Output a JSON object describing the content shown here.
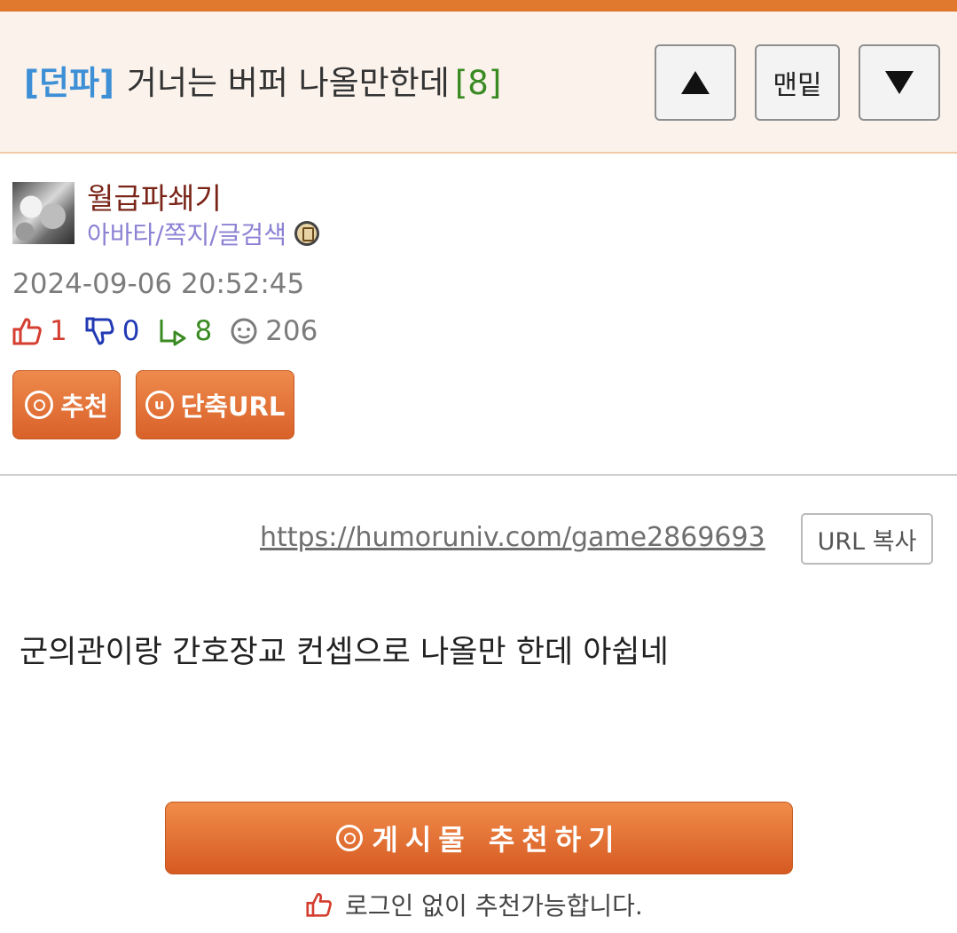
{
  "header": {
    "category": "[던파]",
    "title": "거너는 버퍼 나올만한데",
    "comment_count": "[8]",
    "nav_up_icon": "triangle-up-icon",
    "nav_bottom_label": "맨밑",
    "nav_down_icon": "triangle-down-icon"
  },
  "author": {
    "name": "월급파쇄기",
    "links": "아바타/쪽지/글검색",
    "level_icon": "level-badge-icon"
  },
  "post": {
    "date": "2024-09-06 20:52:45",
    "upvotes": "1",
    "downvotes": "0",
    "replies": "8",
    "views": "206",
    "recommend_label": "추천",
    "shorturl_label": "단축URL",
    "shorturl_icon_letter": "u",
    "url": "https://humoruniv.com/game2869693",
    "copy_label": "URL 복사",
    "content": "군의관이랑 간호장교 컨셉으로 나올만 한데 아쉽네",
    "big_recommend_label": "게시물 추천하기",
    "note": "로그인 없이 추천가능합니다."
  },
  "colors": {
    "accent": "#e0782e",
    "header_bg": "#faf2eb",
    "category": "#3d8fd6",
    "count": "#3a8a22",
    "username": "#7a2418",
    "links": "#8c82d4",
    "up": "#d43d2f",
    "down": "#2239b4",
    "reply": "#3a8a22"
  }
}
